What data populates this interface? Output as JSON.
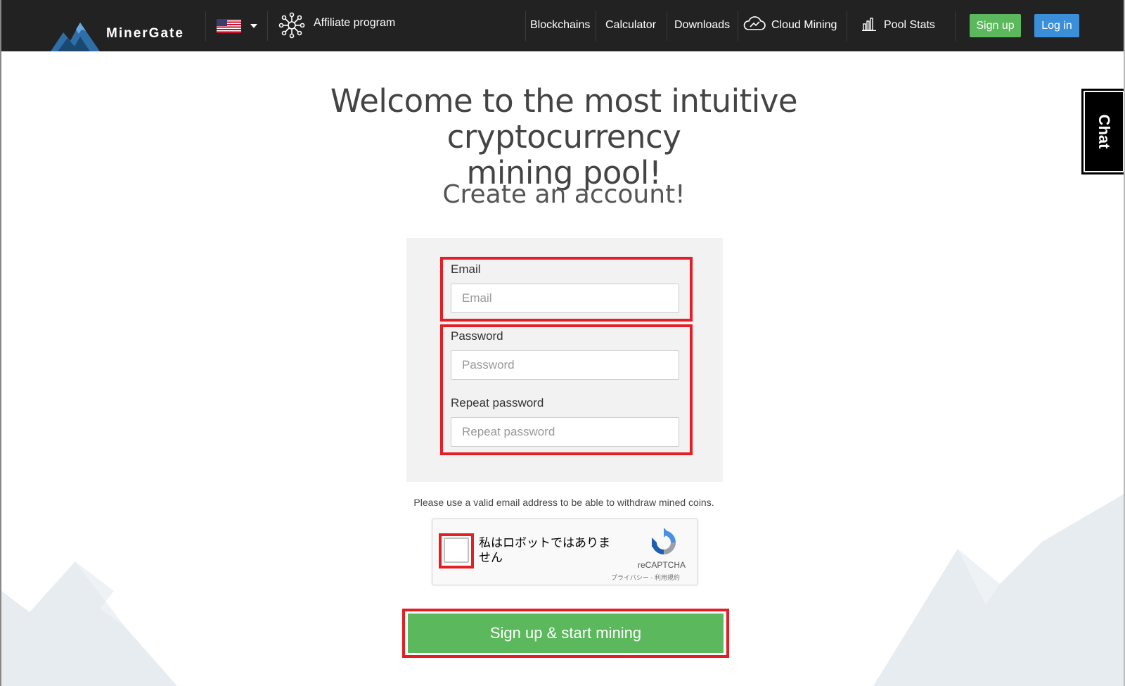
{
  "header": {
    "brand": "MinerGate",
    "affiliate": "Affiliate program",
    "nav": [
      "Blockchains",
      "Calculator",
      "Downloads",
      "Cloud Mining",
      "Pool Stats"
    ],
    "signup_label": "Sign up",
    "login_label": "Log in",
    "language_icon": "us-flag-icon"
  },
  "chat": {
    "label": "Chat"
  },
  "main": {
    "headline_line1": "Welcome to the most intuitive cryptocurrency",
    "headline_line2": "mining pool!",
    "subheading": "Create an account!"
  },
  "form": {
    "email_label": "Email",
    "email_placeholder": "Email",
    "password_label": "Password",
    "password_placeholder": "Password",
    "repeat_label": "Repeat password",
    "repeat_placeholder": "Repeat password",
    "note": "Please use a valid email address to be able to withdraw mined coins.",
    "submit_label": "Sign up & start mining"
  },
  "captcha": {
    "text": "私はロボットではありません",
    "brand": "reCAPTCHA",
    "terms": "プライバシー - 利用規約"
  },
  "colors": {
    "navbar": "#222222",
    "signup_green": "#5cb85c",
    "login_blue": "#3a8fd8",
    "highlight_red": "#e31e25"
  }
}
